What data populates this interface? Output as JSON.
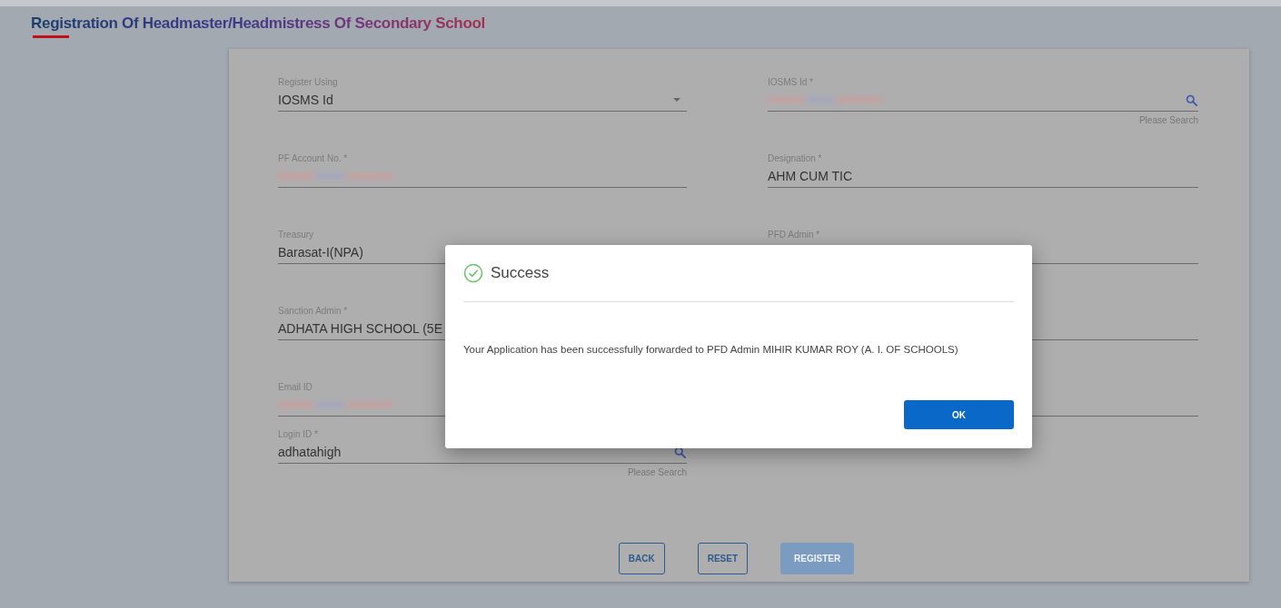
{
  "title": "Registration Of Headmaster/Headmistress Of Secondary School",
  "fields": [
    {
      "kind": "select",
      "label": "Register Using",
      "value": "IOSMS Id"
    },
    {
      "kind": "search",
      "label": "IOSMS Id *",
      "blurred": true,
      "hint": "Please Search"
    },
    {
      "kind": "text",
      "label": "PF Account No. *",
      "blurred": true
    },
    {
      "kind": "text",
      "label": "Designation *",
      "value": "AHM CUM TIC"
    },
    {
      "kind": "text",
      "label": "Treasury",
      "value": "Barasat-I(NPA)"
    },
    {
      "kind": "text",
      "label": "PFD Admin *"
    },
    {
      "kind": "text",
      "label": "Sanction Admin *",
      "value": "ADHATA HIGH SCHOOL (5E"
    },
    {
      "kind": "text"
    },
    {
      "kind": "text",
      "label": "Email ID",
      "blurred": true
    },
    {
      "kind": "text"
    },
    {
      "kind": "search",
      "label": "Login ID *",
      "value": "adhatahigh",
      "hint": "Please Search"
    }
  ],
  "buttons": [
    {
      "label": "BACK",
      "disabled": false
    },
    {
      "label": "RESET",
      "disabled": false
    },
    {
      "label": "REGISTER",
      "disabled": true
    }
  ],
  "dialog": {
    "title": "Success",
    "message": "Your Application has been successfully forwarded to PFD Admin MIHIR KUMAR ROY (A. I. OF SCHOOLS)",
    "button": "OK"
  }
}
